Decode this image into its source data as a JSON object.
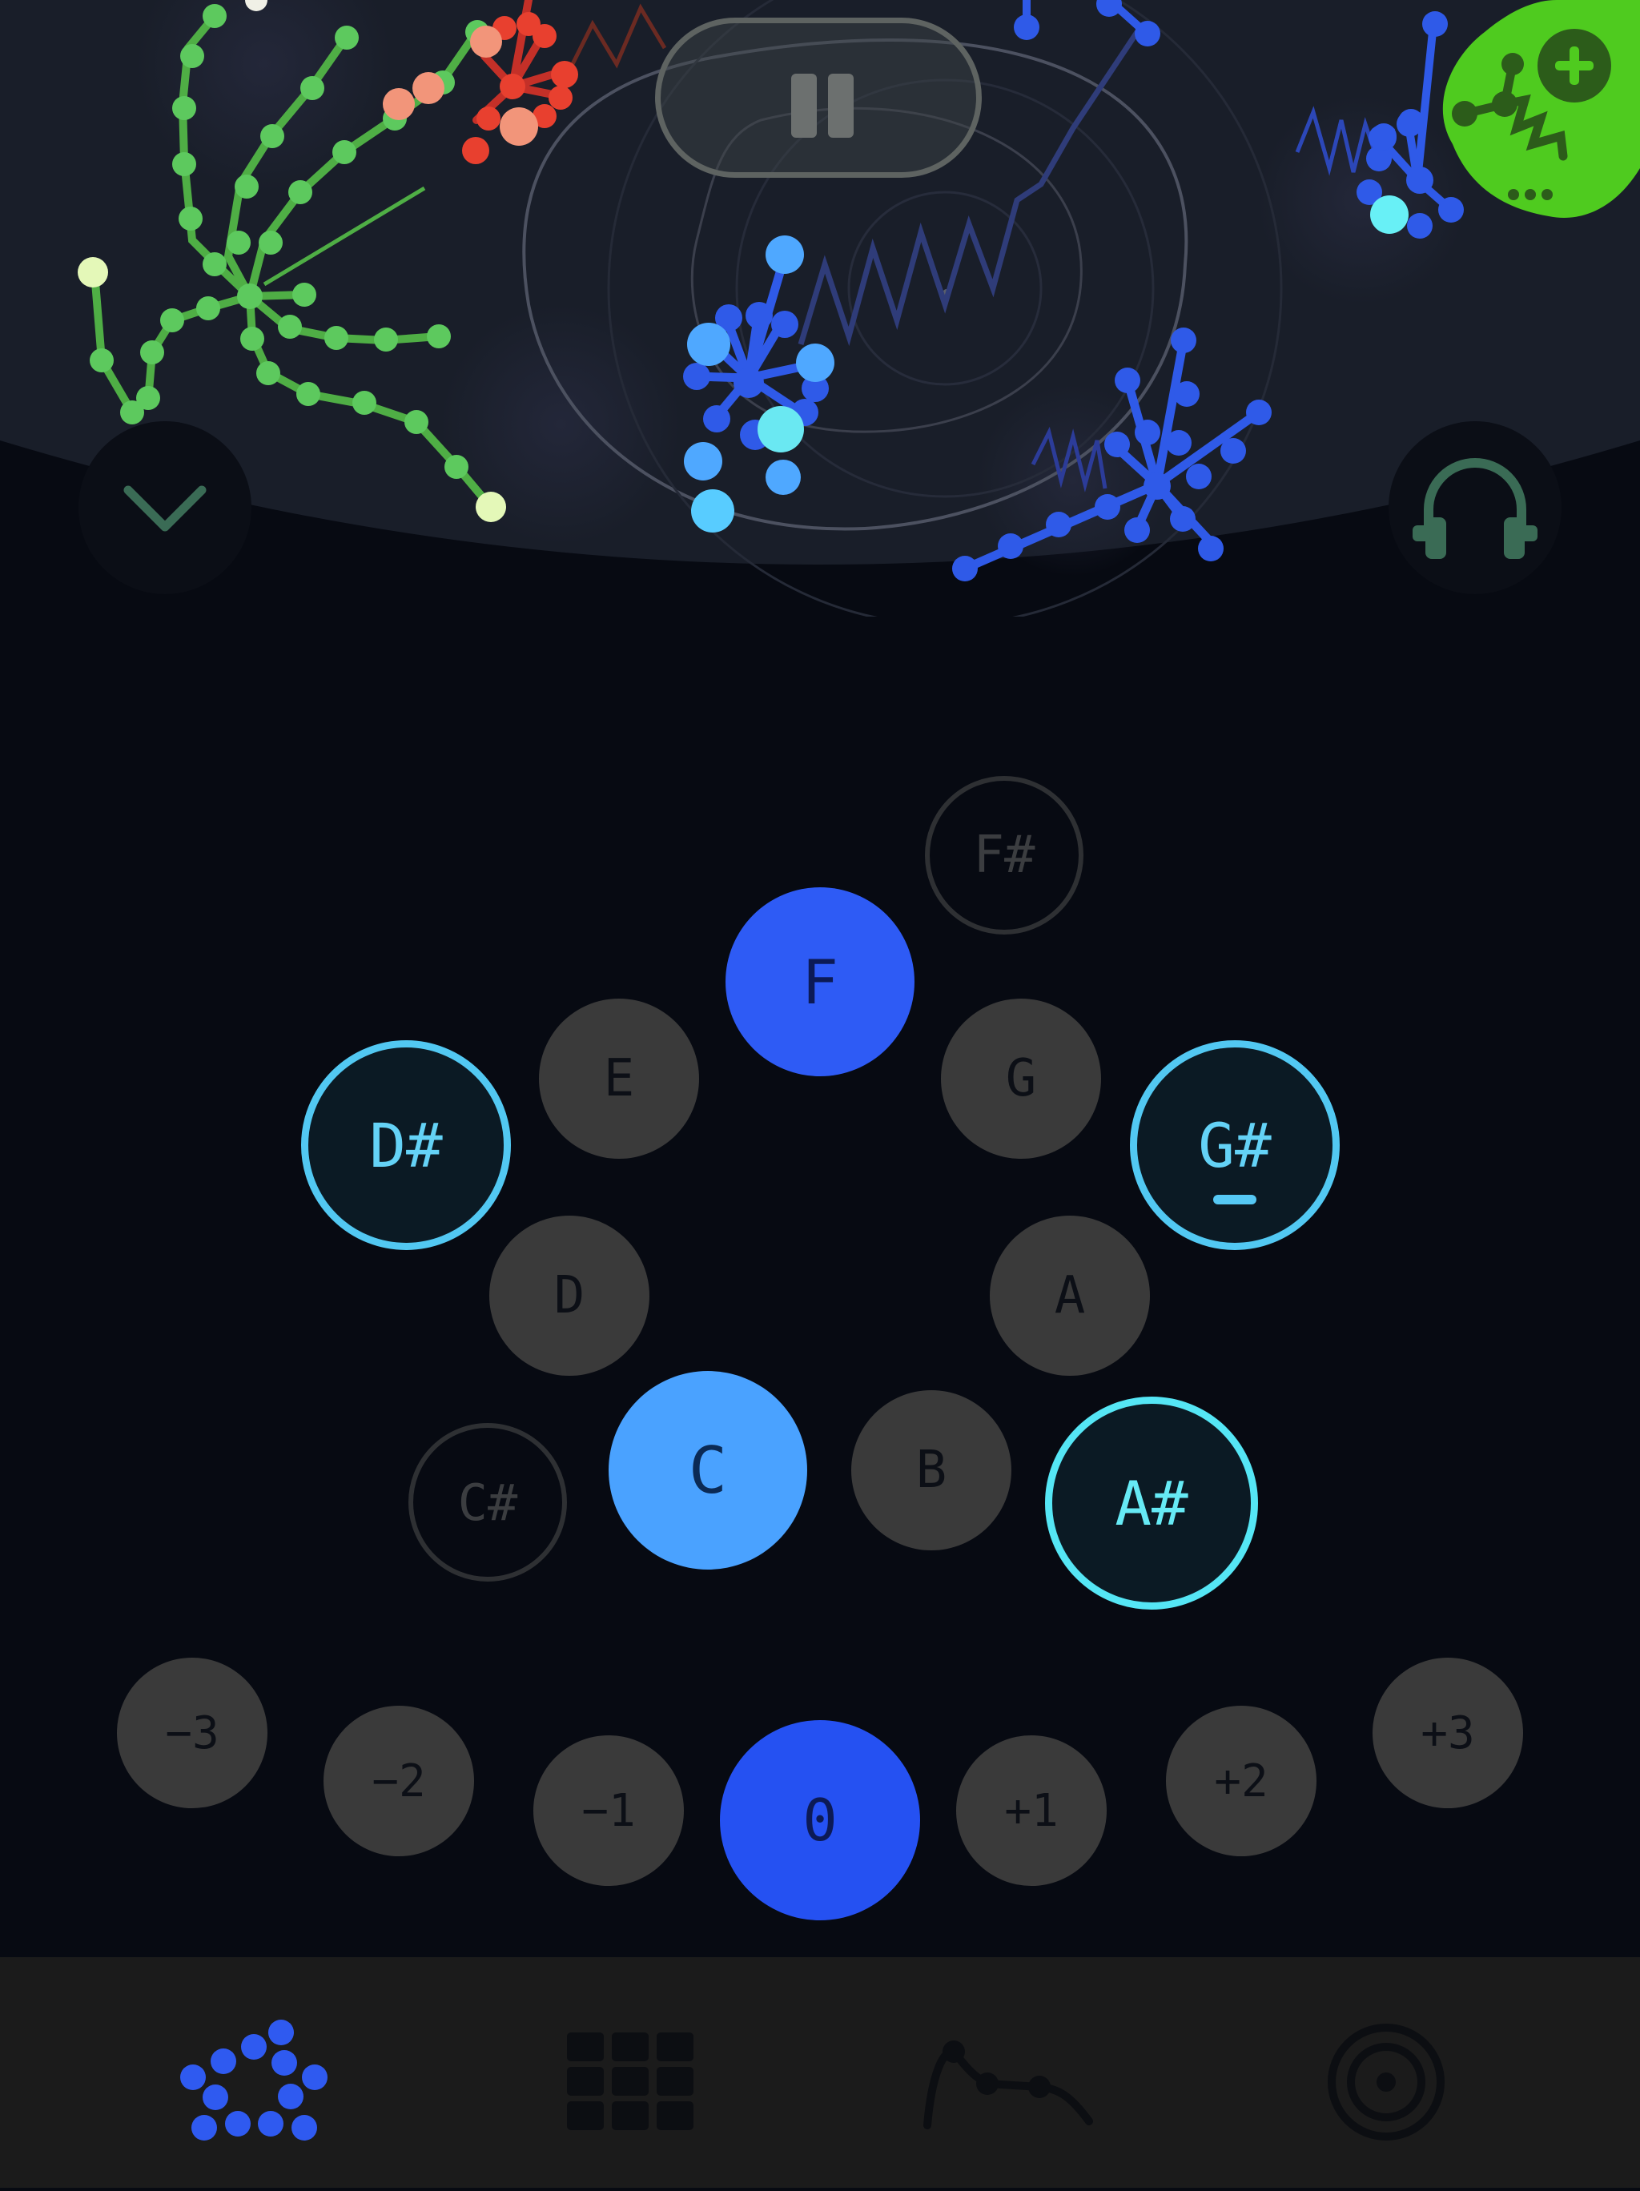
{
  "playback": {
    "button": "pause-icon"
  },
  "header": {
    "collapse_icon": "chevron-down-icon",
    "audio_icon": "headphones-icon",
    "add_icon": "add-patch-icon",
    "more_icon": "more-dots-icon"
  },
  "notes": [
    {
      "id": "note-fsharp",
      "label": "F#",
      "state": "disabled"
    },
    {
      "id": "note-f",
      "label": "F",
      "state": "selected"
    },
    {
      "id": "note-e",
      "label": "E",
      "state": "default"
    },
    {
      "id": "note-g",
      "label": "G",
      "state": "default"
    },
    {
      "id": "note-dsharp",
      "label": "D#",
      "state": "active"
    },
    {
      "id": "note-gsharp",
      "label": "G#",
      "state": "active-minus"
    },
    {
      "id": "note-d",
      "label": "D",
      "state": "default"
    },
    {
      "id": "note-a",
      "label": "A",
      "state": "default"
    },
    {
      "id": "note-csharp",
      "label": "C#",
      "state": "disabled"
    },
    {
      "id": "note-c",
      "label": "C",
      "state": "root"
    },
    {
      "id": "note-b",
      "label": "B",
      "state": "default"
    },
    {
      "id": "note-asharp",
      "label": "A#",
      "state": "active"
    }
  ],
  "octaves": [
    "−3",
    "−2",
    "−1",
    "0",
    "+1",
    "+2",
    "+3"
  ],
  "octave_selected": "0",
  "tabs": [
    {
      "icon": "nodes-icon",
      "selected": true
    },
    {
      "icon": "grid-icon",
      "selected": false
    },
    {
      "icon": "curve-icon",
      "selected": false
    },
    {
      "icon": "target-icon",
      "selected": false
    }
  ],
  "colors": {
    "accent_blue": "#2e5bf5",
    "root_blue": "#4aa2ff",
    "ring_cyan": "#52c8f2",
    "green": "#58c25a",
    "red": "#e84030",
    "add_green": "#4fcb1f"
  }
}
